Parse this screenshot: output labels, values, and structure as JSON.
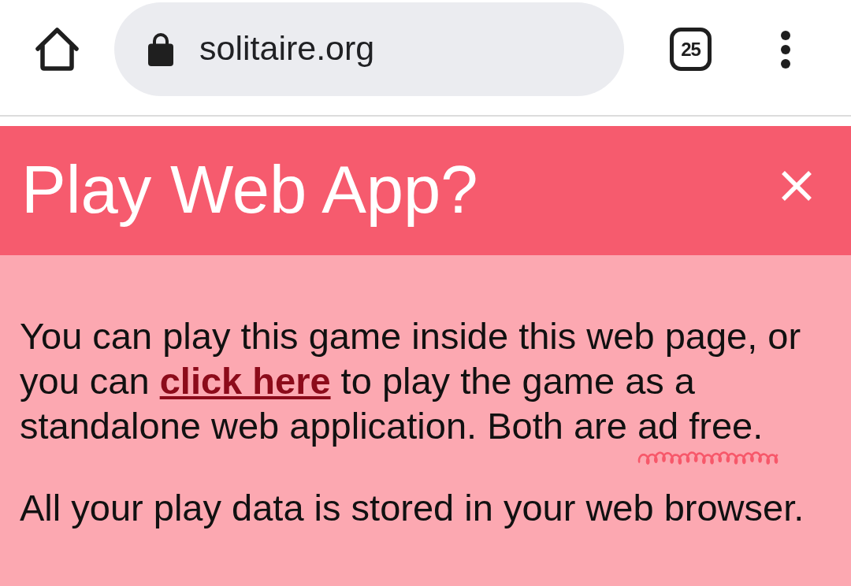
{
  "toolbar": {
    "url": "solitaire.org",
    "tab_count": "25"
  },
  "dialog": {
    "title": "Play Web App?",
    "intro": {
      "before": "You can play this game inside this web page, or you can ",
      "link": "click here",
      "after": " to play the game as a standalone web application. Both are ad free."
    },
    "note": "All your play data is stored in your web browser."
  }
}
